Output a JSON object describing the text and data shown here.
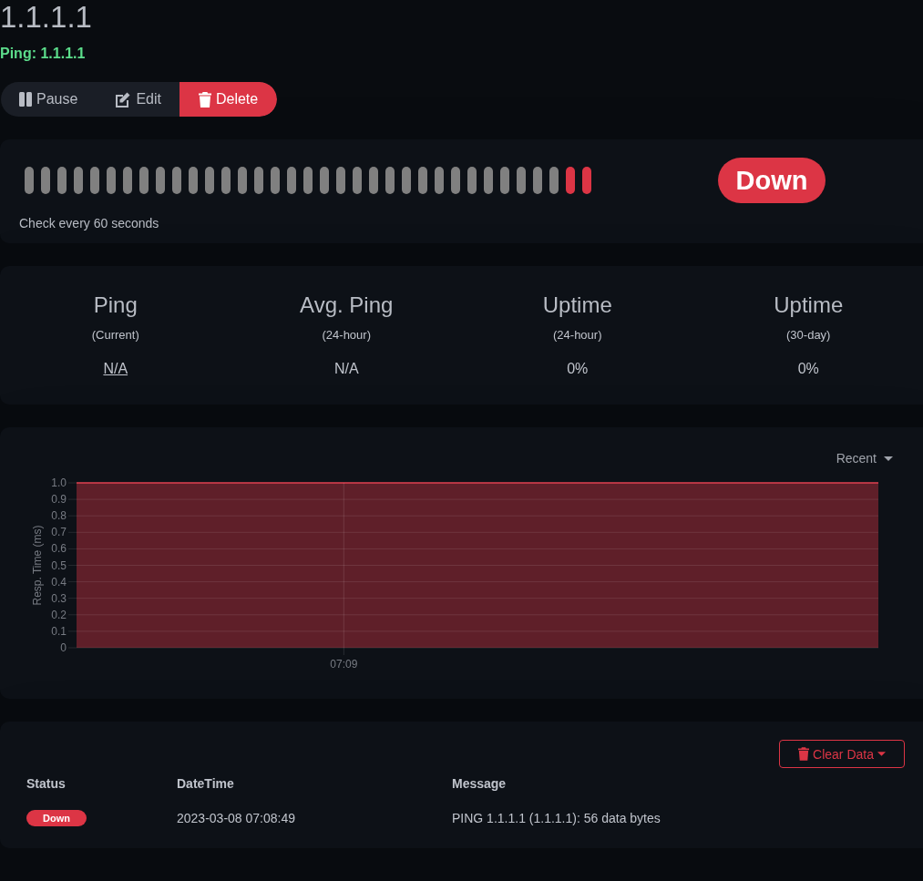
{
  "title": "1.1.1.1",
  "subtitle": "Ping: 1.1.1.1",
  "actions": [
    {
      "label": "Pause",
      "kind": "pause"
    },
    {
      "label": "Edit",
      "kind": "edit"
    },
    {
      "label": "Delete",
      "kind": "delete"
    }
  ],
  "heartbeat": {
    "beats": [
      {
        "color": "#808080"
      },
      {
        "color": "#808080"
      },
      {
        "color": "#808080"
      },
      {
        "color": "#808080"
      },
      {
        "color": "#808080"
      },
      {
        "color": "#808080"
      },
      {
        "color": "#808080"
      },
      {
        "color": "#808080"
      },
      {
        "color": "#808080"
      },
      {
        "color": "#808080"
      },
      {
        "color": "#808080"
      },
      {
        "color": "#808080"
      },
      {
        "color": "#808080"
      },
      {
        "color": "#808080"
      },
      {
        "color": "#808080"
      },
      {
        "color": "#808080"
      },
      {
        "color": "#808080"
      },
      {
        "color": "#808080"
      },
      {
        "color": "#808080"
      },
      {
        "color": "#808080"
      },
      {
        "color": "#808080"
      },
      {
        "color": "#808080"
      },
      {
        "color": "#808080"
      },
      {
        "color": "#808080"
      },
      {
        "color": "#808080"
      },
      {
        "color": "#808080"
      },
      {
        "color": "#808080"
      },
      {
        "color": "#808080"
      },
      {
        "color": "#808080"
      },
      {
        "color": "#808080"
      },
      {
        "color": "#808080"
      },
      {
        "color": "#808080"
      },
      {
        "color": "#808080"
      },
      {
        "color": "#dc3545"
      },
      {
        "color": "#dc3545"
      }
    ],
    "status": {
      "label": "Down",
      "kind": "down"
    },
    "interval": "Check every 60 seconds"
  },
  "stats": [
    {
      "title": "Ping",
      "sub": "(Current)",
      "value": "N/A",
      "link": true
    },
    {
      "title": "Avg. Ping",
      "sub": "(24-hour)",
      "value": "N/A",
      "link": false
    },
    {
      "title": "Uptime",
      "sub": "(24-hour)",
      "value": "0%",
      "link": false
    },
    {
      "title": "Uptime",
      "sub": "(30-day)",
      "value": "0%",
      "link": false
    }
  ],
  "chart": {
    "period": "Recent",
    "chart_data": {
      "type": "area",
      "ylabel": "Resp. Time (ms)",
      "ylim": [
        0,
        1
      ],
      "grid": true,
      "categories": [
        null,
        "07:09",
        null,
        null
      ],
      "series": [
        {
          "color": "#dc3545",
          "values": [
            1,
            1,
            1,
            1
          ]
        }
      ],
      "yticks": [
        {
          "value": 0,
          "label": "0"
        },
        {
          "value": 0.1,
          "label": "0.1"
        },
        {
          "value": 0.2,
          "label": "0.2"
        },
        {
          "value": 0.3,
          "label": "0.3"
        },
        {
          "value": 0.4,
          "label": "0.4"
        },
        {
          "value": 0.5,
          "label": "0.5"
        },
        {
          "value": 0.6,
          "label": "0.6"
        },
        {
          "value": 0.7,
          "label": "0.7"
        },
        {
          "value": 0.8,
          "label": "0.8"
        },
        {
          "value": 0.9,
          "label": "0.9"
        },
        {
          "value": 1,
          "label": "1.0"
        }
      ]
    }
  },
  "events": {
    "clear_button": "Clear Data",
    "columns": [
      "Status",
      "DateTime",
      "Message"
    ],
    "rows": [
      {
        "status": "Down",
        "kind": "down",
        "datetime": "2023-03-08 07:08:49",
        "message": "PING 1.1.1.1 (1.1.1.1): 56 data bytes"
      }
    ]
  }
}
